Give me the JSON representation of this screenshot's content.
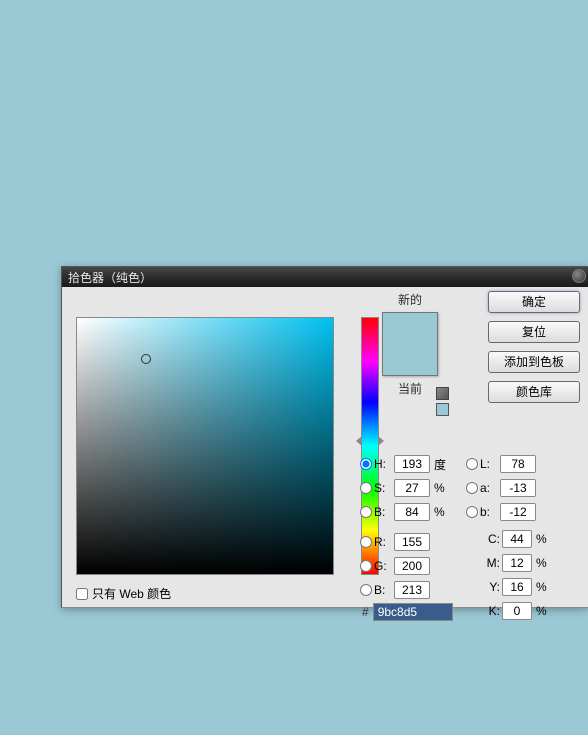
{
  "dialog": {
    "title": "拾色器（纯色）"
  },
  "swatch": {
    "new_label": "新的",
    "current_label": "当前",
    "new_color": "#9bc8d5",
    "current_color": "#9bc8d5"
  },
  "buttons": {
    "ok": "确定",
    "reset": "复位",
    "add_to_swatches": "添加到色板",
    "color_libraries": "颜色库"
  },
  "hsb": {
    "h_label": "H:",
    "h_value": "193",
    "h_unit": "度",
    "s_label": "S:",
    "s_value": "27",
    "s_unit": "%",
    "b_label": "B:",
    "b_value": "84",
    "b_unit": "%"
  },
  "lab": {
    "l_label": "L:",
    "l_value": "78",
    "a_label": "a:",
    "a_value": "-13",
    "b_label": "b:",
    "b_value": "-12"
  },
  "rgb": {
    "r_label": "R:",
    "r_value": "155",
    "g_label": "G:",
    "g_value": "200",
    "b_label": "B:",
    "b_value": "213"
  },
  "cmyk": {
    "c_label": "C:",
    "c_value": "44",
    "m_label": "M:",
    "m_value": "12",
    "y_label": "Y:",
    "y_value": "16",
    "k_label": "K:",
    "k_value": "0",
    "unit": "%"
  },
  "hex": {
    "label": "#",
    "value": "9bc8d5"
  },
  "web_only": {
    "label": "只有 Web 颜色",
    "checked": false
  },
  "sv_cursor": {
    "x_pct": 27,
    "y_pct": 16
  },
  "hue_cursor_pct": 46
}
